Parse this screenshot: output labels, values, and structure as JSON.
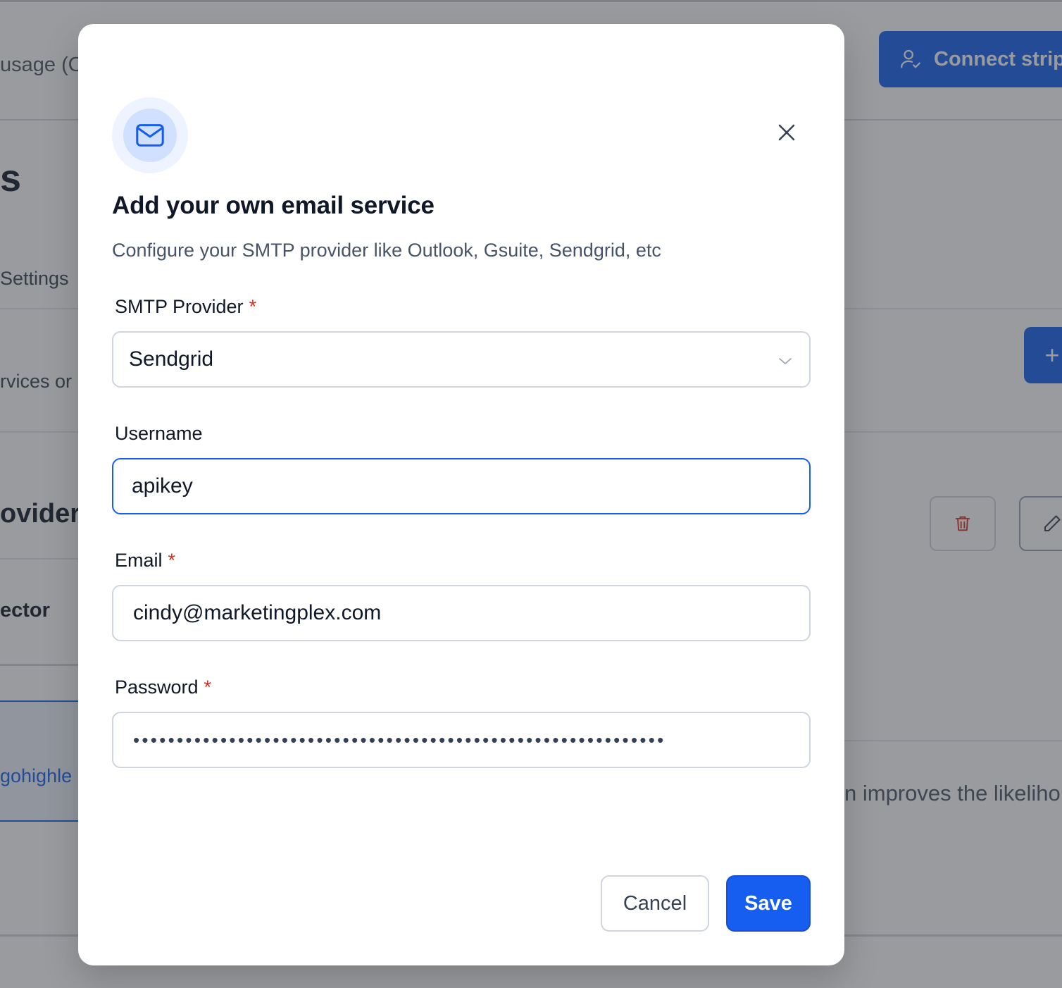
{
  "background": {
    "usage_text": "usage (O",
    "connect_button_label": "Connect strip",
    "heading_fragment": "s",
    "settings_text": "Settings",
    "services_text": "rvices or",
    "add_button_symbol": "+",
    "provider_heading": "ovider",
    "connector_text": "ector",
    "domain_text": "gohighle",
    "improves_text": "n improves the likeliho"
  },
  "modal": {
    "title": "Add your own email service",
    "subtitle": "Configure your SMTP provider like Outlook, Gsuite, Sendgrid, etc",
    "required_mark": "*",
    "fields": {
      "provider": {
        "label": "SMTP Provider",
        "value": "Sendgrid",
        "required": true
      },
      "username": {
        "label": "Username",
        "value": "apikey",
        "required": false
      },
      "email": {
        "label": "Email",
        "value": "cindy@marketingplex.com",
        "required": true
      },
      "password": {
        "label": "Password",
        "masked_value": "•••••••••••••••••••••••••••••••••••••••••••••••••••••••••••••",
        "required": true
      }
    },
    "buttons": {
      "cancel": "Cancel",
      "save": "Save"
    }
  },
  "icons": {
    "header": "mail-icon",
    "close": "close-icon",
    "select": "chevron-down-icon",
    "connect": "user-check-icon",
    "delete": "trash-icon",
    "edit": "pencil-icon"
  },
  "colors": {
    "primary": "#155eef",
    "required": "#d92d20",
    "text": "#101828",
    "muted": "#475467",
    "border": "#d0d5dd",
    "overlay": "rgba(52,56,62,0.5)"
  }
}
